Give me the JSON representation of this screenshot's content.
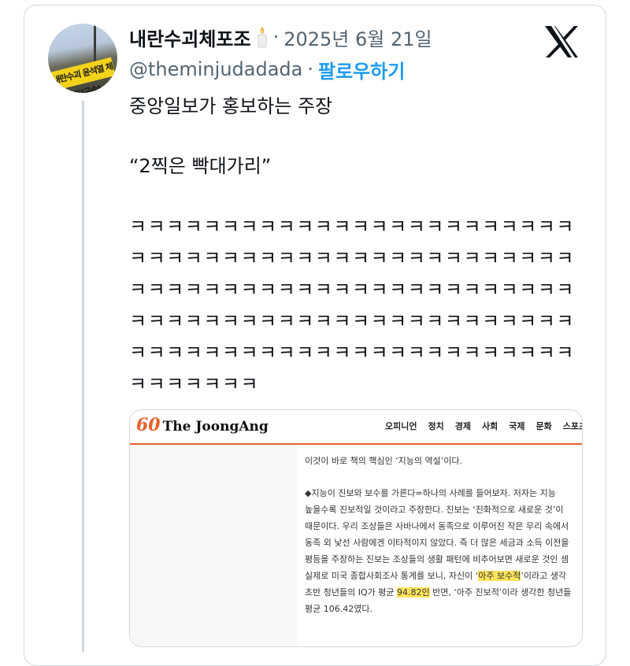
{
  "tweet": {
    "display_name": "내란수괴체포조",
    "status_emoji": "candle-icon",
    "separator": "·",
    "date": "2025년 6월 21일",
    "handle": "@theminjudadada",
    "follow_label": "팔로우하기",
    "platform_icon": "x-logo-icon",
    "avatar_sign_text": "내란수괴 윤석열 체포!구속!",
    "text_line1": "중앙일보가 홍보하는 주장",
    "text_line2": "“2찍은 빡대가리”",
    "laugh_text": "ㅋㅋㅋㅋㅋㅋㅋㅋㅋㅋㅋㅋㅋㅋㅋㅋㅋㅋㅋㅋㅋㅋㅋㅋㅋㅋㅋㅋㅋㅋㅋㅋㅋㅋㅋㅋㅋㅋㅋㅋㅋㅋㅋㅋㅋㅋㅋㅋㅋㅋㅋㅋㅋㅋㅋㅋㅋㅋㅋㅋㅋㅋㅋㅋㅋㅋㅋㅋㅋㅋㅋㅋㅋㅋㅋㅋㅋㅋㅋㅋㅋㅋㅋㅋㅋㅋㅋㅋㅋㅋㅋㅋㅋㅋㅋㅋㅋㅋㅋㅋㅋㅋㅋㅋㅋㅋㅋㅋㅋㅋㅋㅋㅋㅋㅋㅋㅋㅋㅋㅋㅋㅋㅋㅋㅋㅋㅋ"
  },
  "media": {
    "logo_number": "60",
    "logo_name": "The JoongAng",
    "nav": [
      "오피니언",
      "정치",
      "경제",
      "사회",
      "국제",
      "문화",
      "스포츠"
    ],
    "article": {
      "line0": "이것이 바로 책의 핵심인 ‘지능의 역설’이다.",
      "line1": "◆지능이 진보와 보수를 가른다=하나의 사례를 들어보자. 저자는 지능",
      "line2": "높을수록 진보적일 것이라고 주장한다. 진보는 ‘진화적으로 새로운 것’이",
      "line3": "때문이다. 우리 조상들은 사바나에서 동족으로 이루어진 작은 무리 속에서",
      "line4": "동족 외 낯선 사람에겐 이타적이지 않았다. 즉 더 많은 세금과 소득 이전을",
      "line5": "평등을 주장하는 진보는 조상들의 생활 패턴에 비추어보면 새로운 것인 셈",
      "line6_pre": "실제로 미국 종합사회조사 통계를 보니, 자신이 ‘",
      "line6_hl": "아주 보수적",
      "line6_post": "’이라고 생각",
      "line7_pre": "초반 청년들의 IQ가 평균 ",
      "line7_hl": "94.82인",
      "line7_post": " 반면, ‘아주 진보적’이라 생각한 청년들",
      "line8": "평균 106.42였다."
    }
  },
  "colors": {
    "follow_blue": "#1d9bf0",
    "secondary_gray": "#536471",
    "joongang_orange": "#e8612c",
    "highlight_yellow": "#ffe45c"
  }
}
